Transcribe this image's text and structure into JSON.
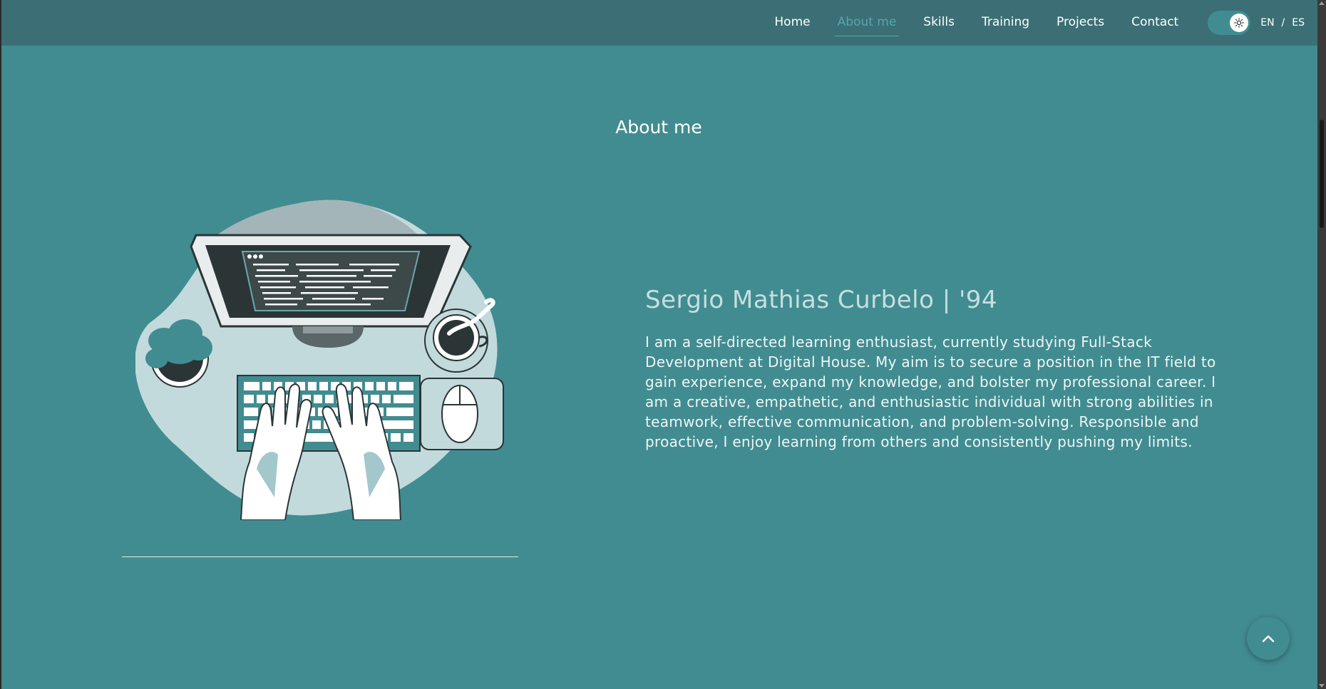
{
  "nav": {
    "links": [
      {
        "label": "Home",
        "active": false
      },
      {
        "label": "About me",
        "active": true
      },
      {
        "label": "Skills",
        "active": false
      },
      {
        "label": "Training",
        "active": false
      },
      {
        "label": "Projects",
        "active": false
      },
      {
        "label": "Contact",
        "active": false
      }
    ],
    "theme_toggle": {
      "icon": "sun-icon",
      "state": "light"
    },
    "languages": [
      "EN",
      "ES"
    ],
    "language_separator": "/"
  },
  "about": {
    "title": "About me",
    "name": "Sergio Mathias Curbelo | '94",
    "bio": "I am a self-directed learning enthusiast, currently studying Full-Stack Development at Digital House. My aim is to secure a position in the IT field to gain experience, expand my knowledge, and bolster my professional career. I am a creative, empathetic, and enthusiastic individual with strong abilities in teamwork, effective communication, and problem-solving. Responsible and proactive, I enjoy learning from others and consistently pushing my limits.",
    "illustration": "desk-computer-illustration"
  },
  "back_to_top": {
    "icon": "chevron-up-icon"
  },
  "colors": {
    "background": "#418c91",
    "navbar": "#3b6f75",
    "active_link": "#55a6ac",
    "name_text": "#c6dfe1"
  }
}
